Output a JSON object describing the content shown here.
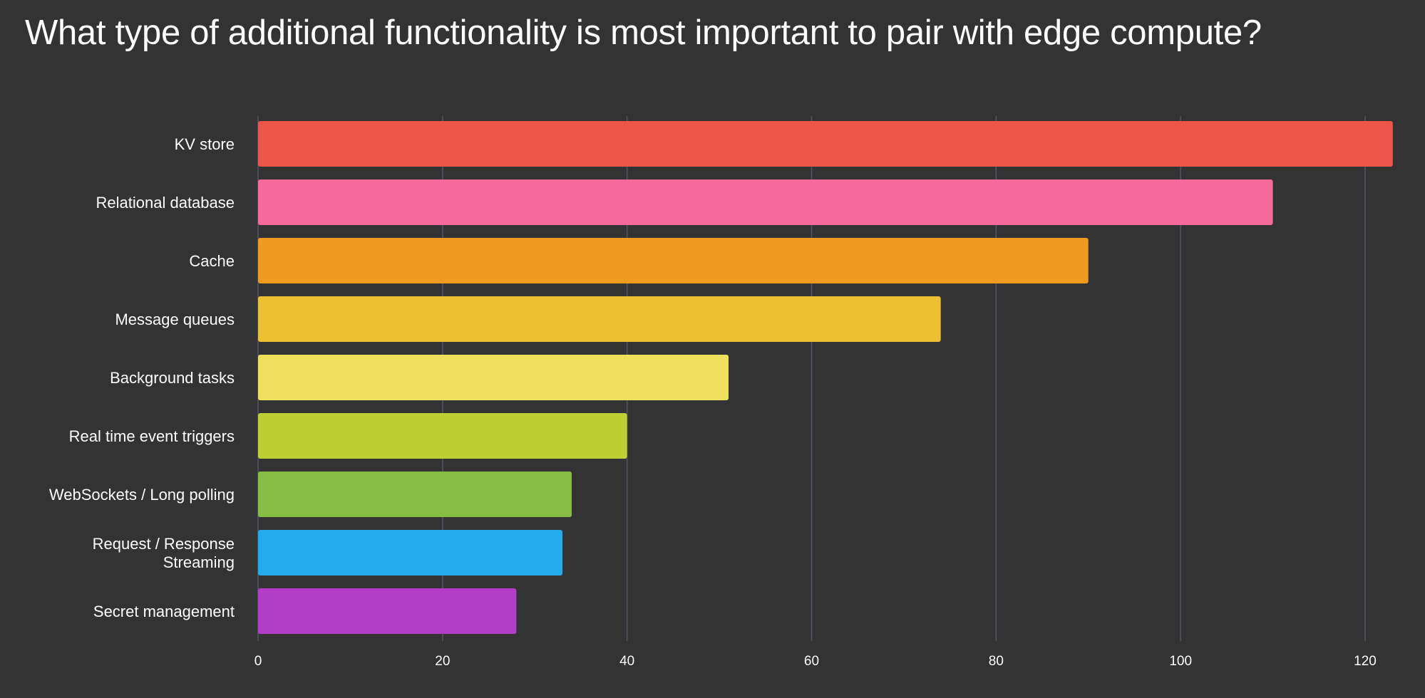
{
  "chart_data": {
    "type": "bar",
    "orientation": "horizontal",
    "title": "What type of additional functionality is most important to pair with edge compute?",
    "xlabel": "",
    "ylabel": "",
    "xlim": [
      0,
      123
    ],
    "xticks": [
      0,
      20,
      40,
      60,
      80,
      100,
      120
    ],
    "grid": true,
    "legend": "none",
    "categories": [
      "KV store",
      "Relational database",
      "Cache",
      "Message queues",
      "Background tasks",
      "Real time event triggers",
      "WebSockets / Long polling",
      "Request / Response Streaming",
      "Secret management"
    ],
    "category_lines": [
      [
        "KV store"
      ],
      [
        "Relational database"
      ],
      [
        "Cache"
      ],
      [
        "Message queues"
      ],
      [
        "Background tasks"
      ],
      [
        "Real time event triggers"
      ],
      [
        "WebSockets / Long polling"
      ],
      [
        "Request / Response",
        "Streaming"
      ],
      [
        "Secret management"
      ]
    ],
    "values": [
      123,
      110,
      90,
      74,
      51,
      40,
      34,
      33,
      28
    ],
    "colors": [
      "#ec5548",
      "#f46a9b",
      "#ef9b20",
      "#edbf33",
      "#ede15b",
      "#bdcf32",
      "#87bc45",
      "#22aced",
      "#b33dc6"
    ],
    "gridline_color": "#55556a",
    "background": "#333333"
  }
}
